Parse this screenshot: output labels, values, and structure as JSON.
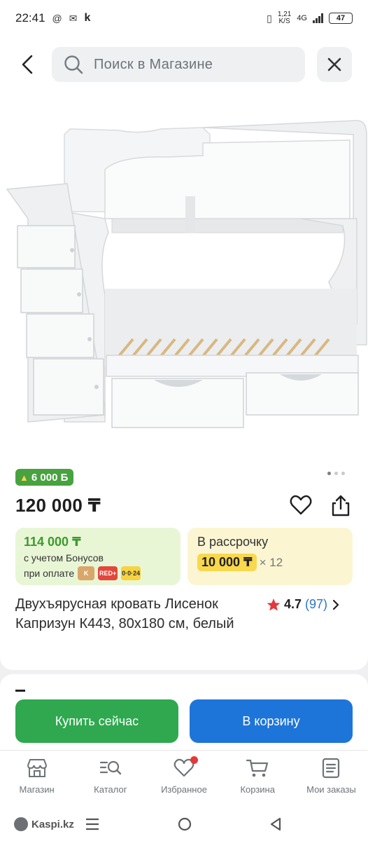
{
  "status_bar": {
    "time": "22:41",
    "app_letter": "k",
    "speed_top": "1,21",
    "speed_bottom": "K/S",
    "network": "4G",
    "battery": "47"
  },
  "header": {
    "search_placeholder": "Поиск в Магазине"
  },
  "product": {
    "bonus_badge": "6 000 Б",
    "price": "120 000 ₸",
    "bonus_price": "114 000 ₸",
    "bonus_note": "с учетом Бонусов",
    "bonus_pay_label": "при оплате",
    "pay_methods": [
      "RED+",
      "0·0·24"
    ],
    "credit_title": "В рассрочку",
    "credit_amount": "10 000 ₸",
    "credit_multiplier": "× 12",
    "title": "Двухъярусная кровать Лисенок Капризун К443, 80х180 см, белый",
    "rating": "4.7",
    "reviews": "(97)",
    "image_dots": {
      "count": 3,
      "active": 0
    }
  },
  "actions": {
    "buy_now": "Купить сейчас",
    "add_to_cart": "В корзину"
  },
  "bottom_nav": [
    {
      "label": "Магазин",
      "icon": "shop-icon"
    },
    {
      "label": "Каталог",
      "icon": "catalog-search-icon"
    },
    {
      "label": "Избранное",
      "icon": "heart-icon"
    },
    {
      "label": "Корзина",
      "icon": "cart-icon"
    },
    {
      "label": "Мои заказы",
      "icon": "orders-icon"
    }
  ],
  "system_nav": {
    "brand": "Kaspi.kz"
  },
  "colors": {
    "green": "#2fa84f",
    "blue": "#1e75d9",
    "bonus_green": "#47a23f",
    "credit_yellow": "#f8d84c",
    "link_blue": "#2a75c9",
    "red_dot": "#e3393a"
  }
}
